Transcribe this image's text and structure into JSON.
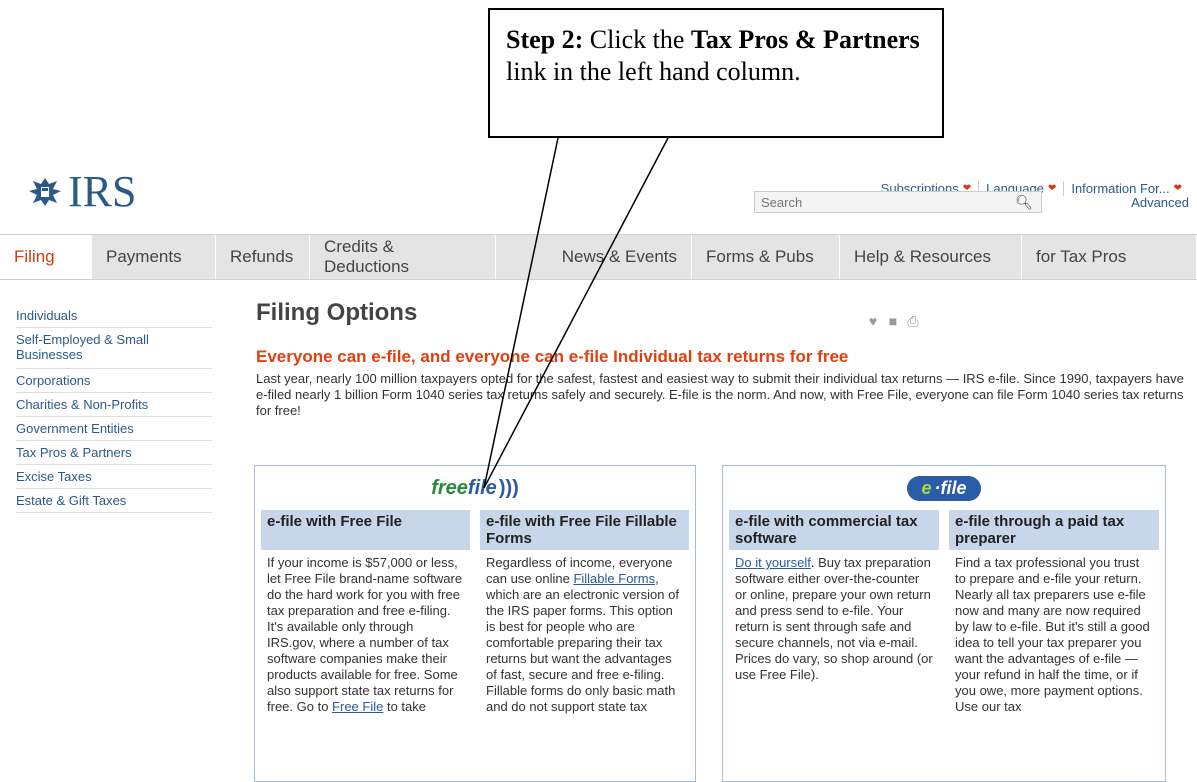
{
  "callout": {
    "step_label": "Step 2:",
    "text_1": " Click the ",
    "link_name": "Tax Pros & Partners",
    "text_2": " link in the left hand column."
  },
  "header": {
    "logo_text": "IRS",
    "util_nav": [
      "Subscriptions",
      "Language",
      "Information For..."
    ],
    "search_placeholder": "Search",
    "advanced_label": "Advanced"
  },
  "tabs": [
    "Filing",
    "Payments",
    "Refunds",
    "Credits & Deductions",
    "News & Events",
    "Forms & Pubs",
    "Help & Resources",
    "for Tax Pros"
  ],
  "sidebar": [
    "Individuals",
    "Self-Employed & Small Businesses",
    "Corporations",
    "Charities & Non-Profits",
    "Government Entities",
    "Tax Pros & Partners",
    "Excise Taxes",
    "Estate & Gift Taxes"
  ],
  "main": {
    "title": "Filing Options",
    "headline": "Everyone can e-file, and everyone can e-file Individual tax returns for free",
    "intro": "Last year, nearly 100 million taxpayers opted for the safest, fastest and easiest way to submit their individual tax returns — IRS e-file. Since 1990, taxpayers have e-filed nearly 1 billion Form 1040 series tax returns safely and securely. E-file is the norm. And now, with Free File, everyone can file Form 1040 series tax returns for free!"
  },
  "boxes": {
    "freefile_logo": {
      "part1": "free",
      "part2": "file"
    },
    "efile_logo": {
      "e": "e",
      "rest": "·file"
    },
    "col1": {
      "heading": "e-file with Free File",
      "body": "If your income is $57,000 or less, let Free File brand-name software do the hard work for you with free tax preparation and free e-filing. It's available only through IRS.gov, where a number of tax software companies make their products available for free. Some also support state tax returns for free. Go to ",
      "link": "Free File",
      "body_end": " to take"
    },
    "col2": {
      "heading": "e-file with Free File Fillable Forms",
      "body_1": "Regardless of income, everyone can use online ",
      "link": "Fillable Forms",
      "body_2": ", which are an electronic version of the IRS paper forms. This option is best for people who are comfortable preparing their tax returns but want the advantages of fast, secure and free e-filing. Fillable forms do only basic math and do not support state tax"
    },
    "col3": {
      "heading": "e-file with commercial tax software",
      "link": "Do it yourself",
      "body": ". Buy tax preparation software either over-the-counter or online, prepare your own return and press send to e-file. Your return is sent through safe and secure channels, not via e-mail. Prices do vary, so shop around (or use Free File)."
    },
    "col4": {
      "heading": "e-file through a paid tax preparer",
      "body": "Find a tax professional you trust to prepare and e-file your return. Nearly all tax preparers use e-file now and many are now required by law to e-file. But it's still a good idea to tell your tax preparer you want the advantages of e-file — your refund in half the time, or if you owe, more payment options. Use our tax"
    }
  },
  "colors": {
    "accent": "#d63a10",
    "link": "#2b5a8a",
    "tab_bg": "#e4e4e4",
    "col_header": "#c8d6ea"
  }
}
